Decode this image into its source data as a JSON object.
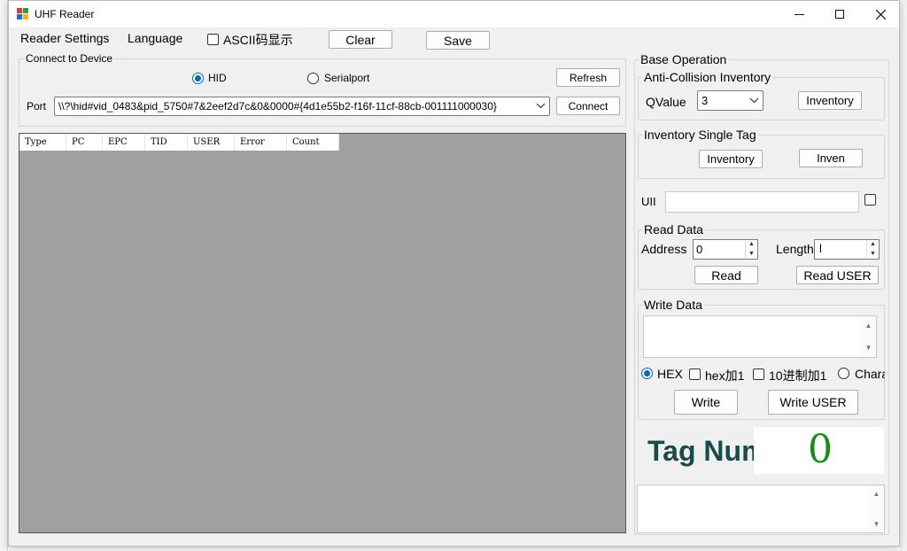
{
  "window": {
    "title": "UHF Reader"
  },
  "menu": {
    "reader_settings": "Reader Settings",
    "language": "Language",
    "ascii_label": "ASCII码显示",
    "clear": "Clear",
    "save": "Save"
  },
  "connect": {
    "group_title": "Connect to Device",
    "hid_label": "HID",
    "serial_label": "Serialport",
    "refresh": "Refresh",
    "port_label": "Port",
    "port_value": "\\\\?\\hid#vid_0483&pid_5750#7&2eef2d7c&0&0000#{4d1e55b2-f16f-11cf-88cb-001111000030}",
    "connect": "Connect",
    "selected_mode": "HID"
  },
  "table": {
    "columns": [
      "Type",
      "PC",
      "EPC",
      "TID",
      "USER",
      "Error",
      "Count"
    ]
  },
  "base": {
    "title": "Base Operation",
    "anti_collision": {
      "title": "Anti-Collision Inventory",
      "qvalue_label": "QValue",
      "qvalue": "3",
      "inventory": "Inventory"
    },
    "single": {
      "title": "Inventory Single Tag",
      "inventory": "Inventory",
      "inven": "Inven"
    },
    "uii_label": "UII",
    "read": {
      "title": "Read Data",
      "address_label": "Address",
      "address": "0",
      "length_label": "Length",
      "length": "l",
      "read": "Read",
      "read_user": "Read USER"
    },
    "write": {
      "title": "Write Data",
      "hex": "HEX",
      "hex_plus1": "hex加1",
      "dec_plus1": "10进制加1",
      "char": "Chara",
      "write": "Write",
      "write_user": "Write USER"
    },
    "tag_num_label": "Tag Num",
    "tag_num_value": "0"
  },
  "colors": {
    "accent": "#0067c0",
    "tag_num_label": "#1b4a4a",
    "tag_num_value": "#1a8a1a",
    "list_bg": "#a0a0a0"
  }
}
